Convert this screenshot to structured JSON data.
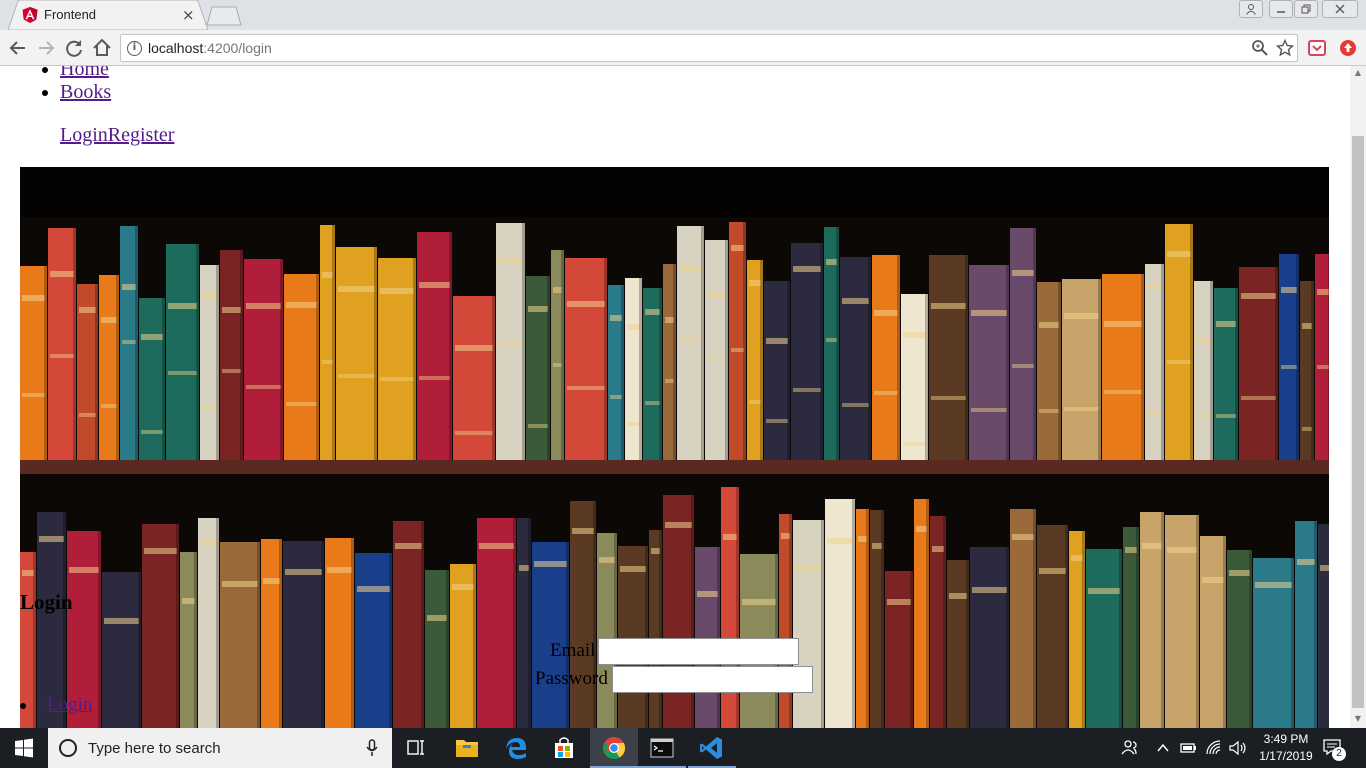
{
  "browser": {
    "tab": {
      "title": "Frontend",
      "close_glyph": "×",
      "favicon": "angular-logo-icon"
    },
    "window_buttons": {
      "profile": "person-icon",
      "minimize": "minimize-icon",
      "restore": "restore-icon",
      "close": "close-icon"
    },
    "address": {
      "host": "localhost",
      "rest": ":4200/login"
    },
    "toolbar_icons": [
      "back-arrow-icon",
      "forward-arrow-icon",
      "reload-icon",
      "home-icon",
      "info-icon",
      "zoom-icon",
      "star-icon",
      "pocket-extension-icon",
      "upload-extension-icon"
    ]
  },
  "page": {
    "nav": {
      "items": [
        "Home",
        "Books"
      ]
    },
    "auth": {
      "login": "Login",
      "register": "Register"
    },
    "login_section": {
      "heading": "Login",
      "email_label": "Email",
      "password_label": "Password",
      "email_value": "",
      "password_value": "",
      "bottom_link": "Login"
    },
    "banner": {
      "image": "bookshelf-photo"
    }
  },
  "taskbar": {
    "search_placeholder": "Type here to search",
    "apps": [
      "task-view-icon",
      "file-explorer-icon",
      "edge-icon",
      "store-icon",
      "chrome-icon",
      "terminal-icon",
      "vscode-icon"
    ],
    "time": "3:49 PM",
    "date": "1/17/2019",
    "notification_count": "2"
  },
  "colors": {
    "link": "#551a8b",
    "taskbar": "#1b1f24",
    "tab_strip": "#dee1e6"
  }
}
